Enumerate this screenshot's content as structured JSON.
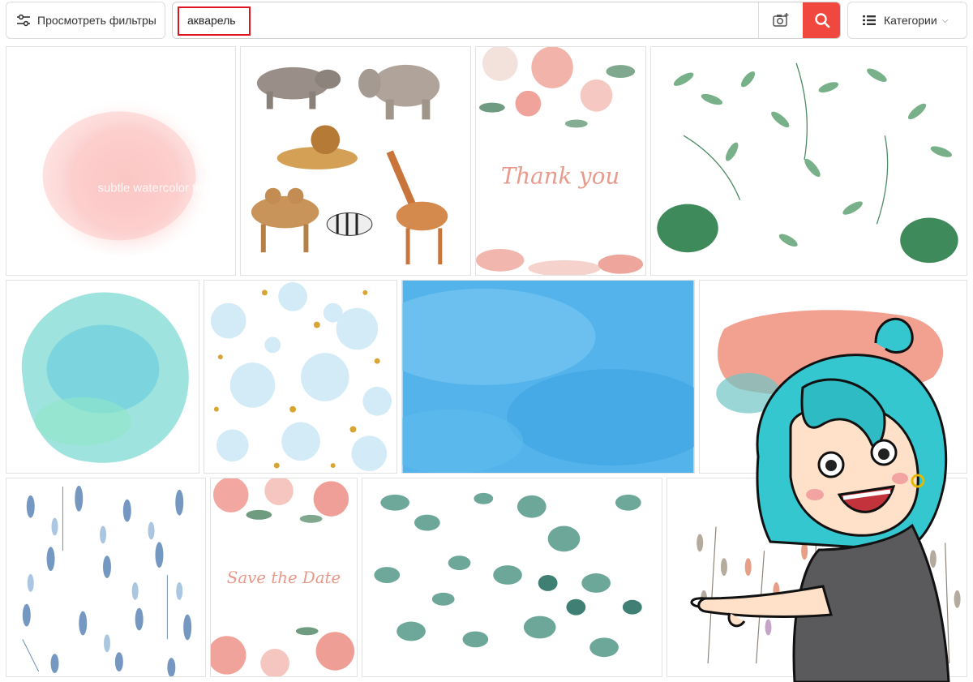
{
  "toolbar": {
    "filters_label": "Просмотреть фильтры",
    "search_value": "акварель",
    "categories_label": "Категории",
    "accent_color": "#f0483e",
    "highlight_color": "#e0141e"
  },
  "tiles": [
    {
      "name": "tile-pink-watercolor-stain",
      "watermark": "subtle watercolor texture"
    },
    {
      "name": "tile-watercolor-animals"
    },
    {
      "name": "tile-thank-you-floral-card",
      "text": "Thank you"
    },
    {
      "name": "tile-green-leaves"
    },
    {
      "name": "tile-turquoise-watercolor-stain"
    },
    {
      "name": "tile-bubbles-gold-dots"
    },
    {
      "name": "tile-blue-watercolor-background"
    },
    {
      "name": "tile-coral-brush-stroke"
    },
    {
      "name": "tile-blue-leaf-pattern"
    },
    {
      "name": "tile-save-the-date-card",
      "text": "Save the Date"
    },
    {
      "name": "tile-eucalyptus-leaves"
    },
    {
      "name": "tile-autumn-branches"
    }
  ],
  "overlay": {
    "name": "cartoon-girl-pointing"
  }
}
